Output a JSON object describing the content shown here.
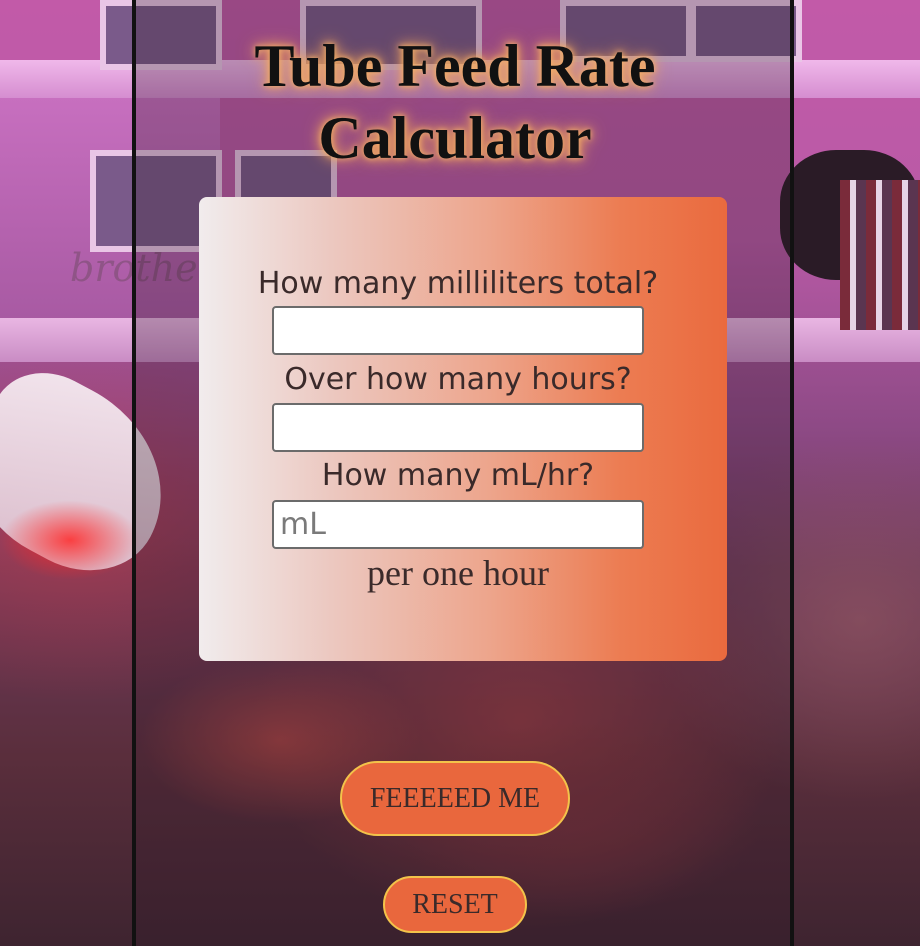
{
  "page": {
    "title": "Tube Feed Rate Calculator",
    "title_glow_color": "#f6b36a"
  },
  "calculator": {
    "total_ml_label": "How many milliliters total?",
    "total_ml_value": "",
    "hours_label": "Over how many hours?",
    "hours_value": "",
    "rate_label": "How many mL/hr?",
    "rate_value": "",
    "rate_placeholder": "mL",
    "unit_text": "per one hour",
    "panel_gradient": [
      "#f1eced",
      "#ea6a3e"
    ]
  },
  "buttons": {
    "feed_label": "FEEEEED ME",
    "reset_label": "RESET",
    "button_color": "#e9673d",
    "button_border_color": "#f3c34a"
  },
  "background": {
    "wall_text": "brother"
  }
}
